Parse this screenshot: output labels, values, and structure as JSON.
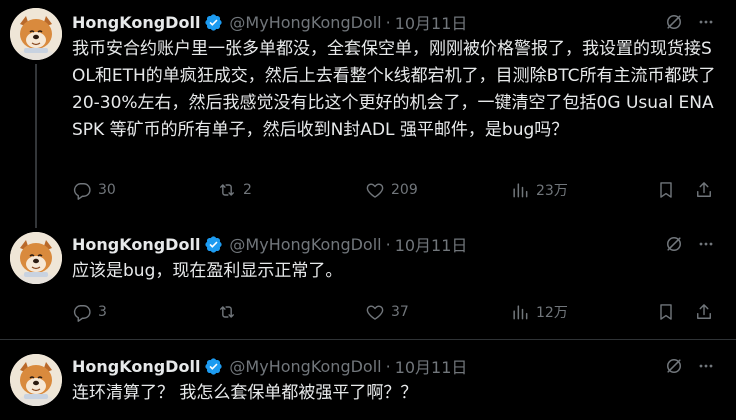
{
  "colors": {
    "background": "#000000",
    "text_primary": "#e7e9ea",
    "text_secondary": "#71767b",
    "verified_blue": "#1d9bf0",
    "divider": "#2f3336"
  },
  "tweets": [
    {
      "author_name": "HongKongDoll",
      "handle": "@MyHongKongDoll",
      "separator": "·",
      "date": "10月11日",
      "text": "我币安合约账户里一张多单都没，全套保空单，刚刚被价格警报了，我设置的现货接SOL和ETH的单疯狂成交，然后上去看整个k线都宕机了，目测除BTC所有主流币都跌了20-30%左右，然后我感觉没有比这个更好的机会了，一键清空了包括0G Usual ENA SPK 等矿币的所有单子，然后收到N封ADL 强平邮件，是bug吗？",
      "replies": "30",
      "reposts": "2",
      "likes": "209",
      "views": "23万"
    },
    {
      "author_name": "HongKongDoll",
      "handle": "@MyHongKongDoll",
      "separator": "·",
      "date": "10月11日",
      "text": "应该是bug，现在盈利显示正常了。",
      "replies": "3",
      "reposts": "",
      "likes": "37",
      "views": "12万"
    },
    {
      "author_name": "HongKongDoll",
      "handle": "@MyHongKongDoll",
      "separator": "·",
      "date": "10月11日",
      "text": "连环清算了？ 我怎么套保单都被强平了啊？？"
    }
  ],
  "icons": {
    "verified": "verified-badge-icon",
    "grok": "grok-icon",
    "more": "more-options-icon",
    "reply": "reply-icon",
    "repost": "repost-icon",
    "like": "heart-icon",
    "views": "views-icon",
    "bookmark": "bookmark-icon",
    "share": "share-icon"
  }
}
